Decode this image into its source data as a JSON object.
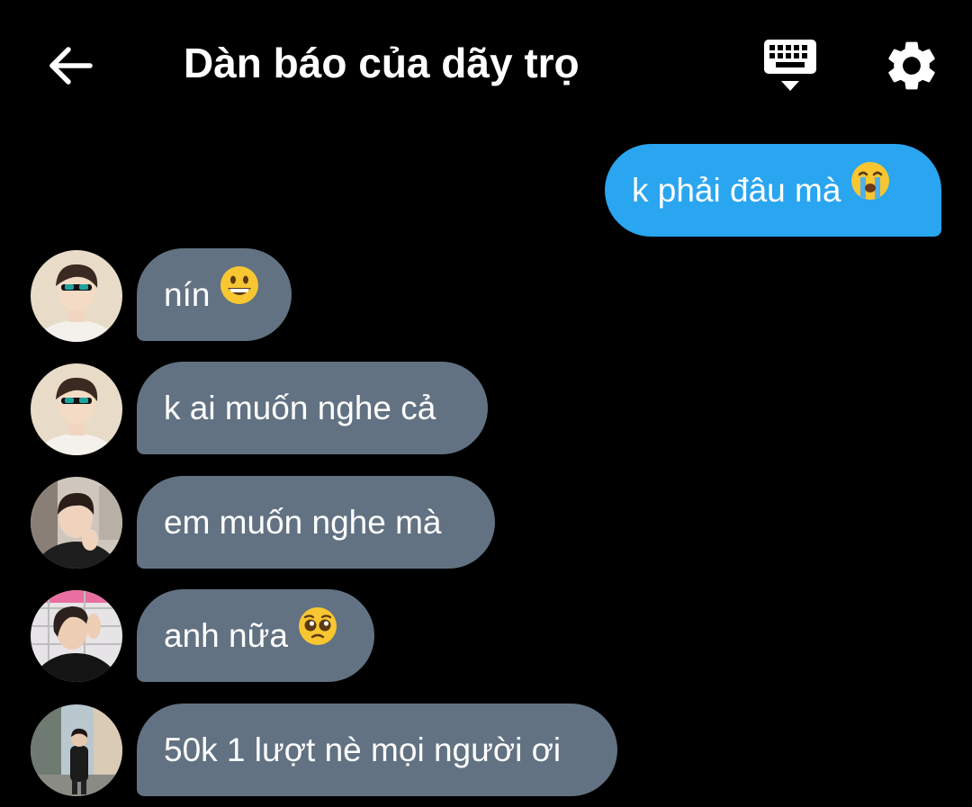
{
  "header": {
    "title": "Dàn báo của dãy trọ",
    "back_icon": "arrow-left-icon",
    "keyboard_icon": "keyboard-icon",
    "settings_icon": "gear-icon"
  },
  "messages": [
    {
      "sender": "self",
      "text": "k phải đâu mà",
      "emoji": "loudly-crying-face"
    },
    {
      "sender": "other",
      "avatar": "avatar-user-1",
      "text": "nín",
      "emoji": "grinning-face"
    },
    {
      "sender": "other",
      "avatar": "avatar-user-1",
      "text": "k ai muốn nghe cả"
    },
    {
      "sender": "other",
      "avatar": "avatar-user-2",
      "text": "em muốn nghe mà"
    },
    {
      "sender": "other",
      "avatar": "avatar-user-3",
      "text": "anh nữa",
      "emoji": "pleading-face"
    },
    {
      "sender": "other",
      "avatar": "avatar-user-4",
      "text": "50k 1 lượt nè mọi người ơi"
    }
  ],
  "colors": {
    "background": "#000000",
    "outgoing_bubble": "#2aa5f0",
    "incoming_bubble": "#627282",
    "text": "#ffffff"
  }
}
